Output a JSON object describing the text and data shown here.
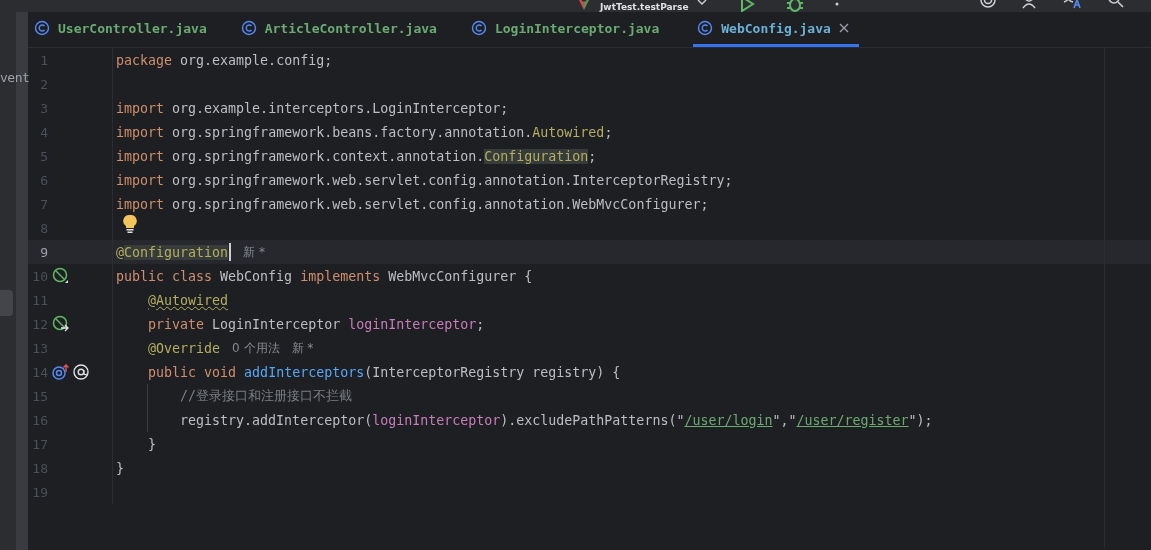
{
  "toolbar": {
    "run_config": "JwtTest.testParse"
  },
  "tabs": [
    {
      "label": "UserController.java",
      "selected": false
    },
    {
      "label": "ArticleController.java",
      "selected": false
    },
    {
      "label": "LoginInterceptor.java",
      "selected": false
    },
    {
      "label": "WebConfig.java",
      "selected": true
    }
  ],
  "side_panel": {
    "label": "vent"
  },
  "editor": {
    "lines": [
      {
        "number": "1",
        "current": false,
        "segments": [
          {
            "kind": "keyword",
            "text": "package"
          },
          {
            "kind": "plain",
            "text": " org.example.config;"
          }
        ]
      },
      {
        "number": "2",
        "current": false
      },
      {
        "number": "3",
        "current": false,
        "segments": [
          {
            "kind": "keyword",
            "text": "import"
          },
          {
            "kind": "plain",
            "text": " org.example.interceptors.LoginInterceptor;"
          }
        ]
      },
      {
        "number": "4",
        "current": false,
        "segments": [
          {
            "kind": "keyword",
            "text": "import"
          },
          {
            "kind": "plain",
            "text": " org.springframework.beans.factory.annotation."
          },
          {
            "kind": "annotation",
            "text": "Autowired"
          },
          {
            "kind": "plain",
            "text": ";"
          }
        ]
      },
      {
        "number": "5",
        "current": false,
        "segments": [
          {
            "kind": "keyword",
            "text": "import"
          },
          {
            "kind": "plain",
            "text": " org.springframework.context.annotation."
          },
          {
            "kind": "annotation",
            "text": "Configuration",
            "highlighted": true
          },
          {
            "kind": "plain",
            "text": ";"
          }
        ]
      },
      {
        "number": "6",
        "current": false,
        "segments": [
          {
            "kind": "keyword",
            "text": "import"
          },
          {
            "kind": "plain",
            "text": " org.springframework.web.servlet.config.annotation.InterceptorRegistry;"
          }
        ]
      },
      {
        "number": "7",
        "current": false,
        "segments": [
          {
            "kind": "keyword",
            "text": "import"
          },
          {
            "kind": "plain",
            "text": " org.springframework.web.servlet.config.annotation.WebMvcConfigurer;"
          }
        ]
      },
      {
        "number": "8",
        "current": false,
        "bulb": true
      },
      {
        "number": "9",
        "current": true,
        "cursor": true,
        "segments": [
          {
            "kind": "annotation",
            "text": "@"
          },
          {
            "kind": "annotation",
            "text": "Configuration",
            "highlighted": true
          }
        ],
        "hints": [
          "新 *"
        ]
      },
      {
        "number": "10",
        "current": false,
        "gutter": [
          {
            "kind": "bean"
          }
        ],
        "segments": [
          {
            "kind": "keyword",
            "text": "public class "
          },
          {
            "kind": "plain",
            "text": "WebConfig "
          },
          {
            "kind": "keyword",
            "text": "implements "
          },
          {
            "kind": "plain",
            "text": "WebMvcConfigurer {"
          }
        ]
      },
      {
        "number": "11",
        "current": false,
        "segments": [
          {
            "kind": "annotation",
            "text": "    @Autowired",
            "warning": true
          }
        ]
      },
      {
        "number": "12",
        "current": false,
        "gutter": [
          {
            "kind": "injected"
          }
        ],
        "segments": [
          {
            "kind": "keyword",
            "text": "    private "
          },
          {
            "kind": "plain",
            "text": "LoginInterceptor "
          },
          {
            "kind": "field",
            "text": "loginInterceptor"
          },
          {
            "kind": "plain",
            "text": ";"
          }
        ]
      },
      {
        "number": "13",
        "current": false,
        "segments": [
          {
            "kind": "annotation",
            "text": "    @Override"
          }
        ],
        "hints": [
          "0 个用法",
          "新 *"
        ]
      },
      {
        "number": "14",
        "current": false,
        "gutter": [
          {
            "kind": "override"
          },
          {
            "kind": "mention"
          }
        ],
        "segments": [
          {
            "kind": "keyword",
            "text": "    public void "
          },
          {
            "kind": "method",
            "text": "addInterceptors"
          },
          {
            "kind": "plain",
            "text": "(InterceptorRegistry registry) {"
          }
        ]
      },
      {
        "number": "15",
        "current": false,
        "guide": true,
        "segments": [
          {
            "kind": "comment",
            "text": "        //登录接口和注册接口不拦截"
          }
        ]
      },
      {
        "number": "16",
        "current": false,
        "guide": true,
        "segments": [
          {
            "kind": "plain",
            "text": "        registry.addInterceptor("
          },
          {
            "kind": "field",
            "text": "loginInterceptor"
          },
          {
            "kind": "plain",
            "text": ").excludePathPatterns(\""
          },
          {
            "kind": "link",
            "text": "/user/login"
          },
          {
            "kind": "plain",
            "text": "\",\""
          },
          {
            "kind": "link",
            "text": "/user/register"
          },
          {
            "kind": "plain",
            "text": "\");"
          }
        ]
      },
      {
        "number": "17",
        "current": false,
        "segments": [
          {
            "kind": "plain",
            "text": "    }"
          }
        ]
      },
      {
        "number": "18",
        "current": false,
        "segments": [
          {
            "kind": "plain",
            "text": "}"
          }
        ]
      },
      {
        "number": "19",
        "current": false
      }
    ]
  }
}
